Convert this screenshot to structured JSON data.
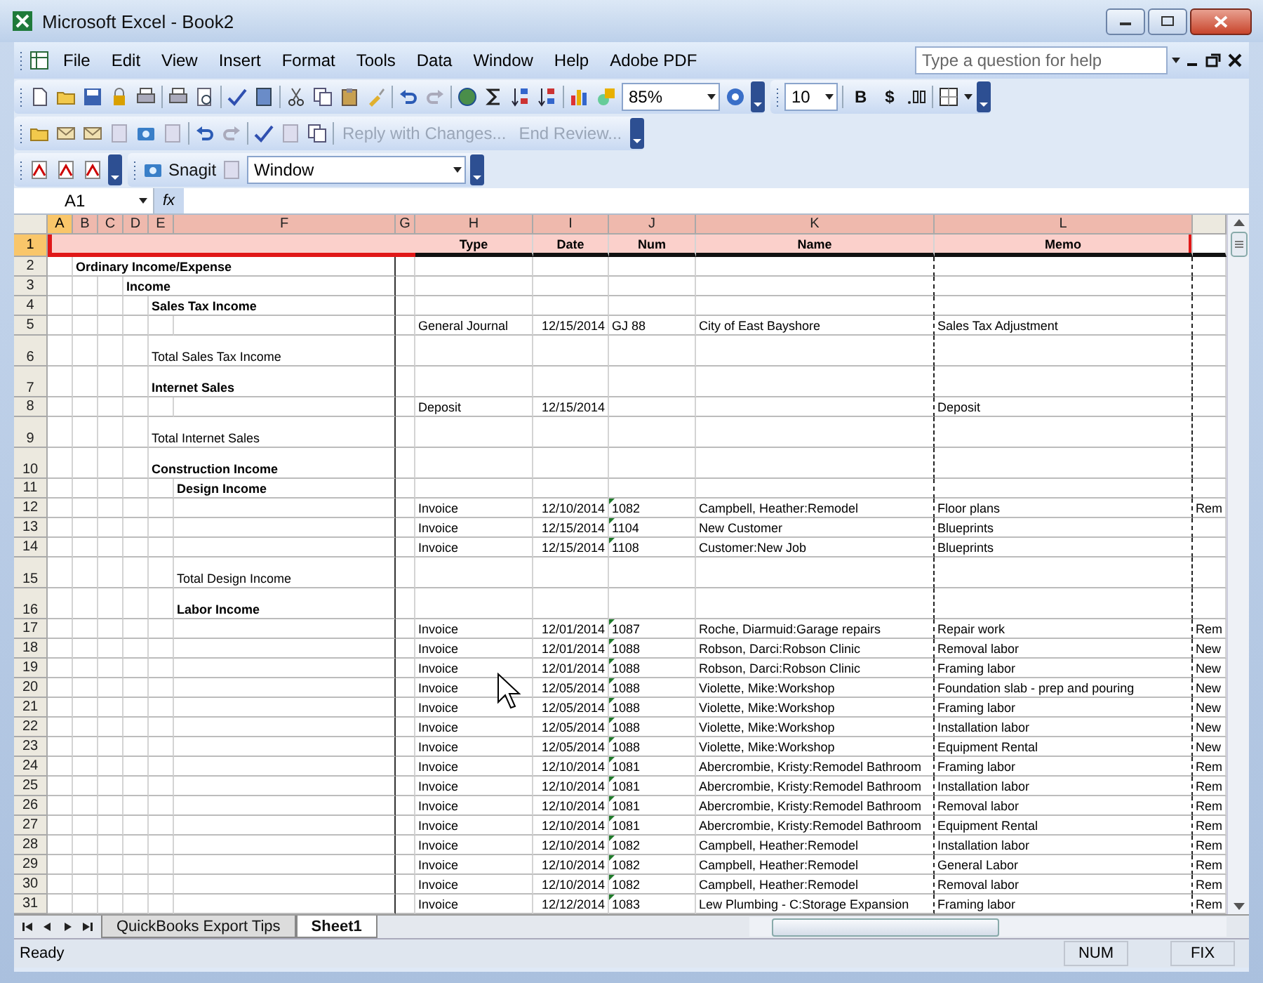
{
  "window": {
    "title": "Microsoft Excel - Book2"
  },
  "menu_bar": {
    "items": [
      "File",
      "Edit",
      "View",
      "Insert",
      "Format",
      "Tools",
      "Data",
      "Window",
      "Help",
      "Adobe PDF"
    ],
    "help_box": {
      "placeholder": "Type a question for help"
    }
  },
  "standard_toolbar": {
    "zoom": "85%"
  },
  "formatting_toolbar": {
    "font_size": "10",
    "buttons": [
      "B",
      "$"
    ]
  },
  "reviewing_toolbar": {
    "items": [
      {
        "label": "Reply with Changes...",
        "disabled": true
      },
      {
        "label": "End Review...",
        "disabled": true
      }
    ]
  },
  "snagit_toolbar": {
    "label": "Snagit",
    "dropdown": "Window"
  },
  "formula_bar": {
    "name_box": "A1",
    "fx": "fx"
  },
  "columns": [
    {
      "letter": "A",
      "selected": true
    },
    {
      "letter": "B",
      "selected": false
    },
    {
      "letter": "C",
      "selected": false
    },
    {
      "letter": "D",
      "selected": false
    },
    {
      "letter": "E",
      "selected": false
    },
    {
      "letter": "F",
      "selected": false
    },
    {
      "letter": "G",
      "selected": false
    },
    {
      "letter": "H",
      "selected": false
    },
    {
      "letter": "I",
      "selected": false
    },
    {
      "letter": "J",
      "selected": false
    },
    {
      "letter": "K",
      "selected": false
    },
    {
      "letter": "L",
      "selected": false
    }
  ],
  "header_row": {
    "number": "1",
    "selected": true,
    "cells": [
      "Type",
      "Date",
      "Num",
      "Name",
      "Memo"
    ]
  },
  "rows": [
    {
      "number": "2",
      "tall": false,
      "label": {
        "text": "Ordinary Income/Expense",
        "kind": "top",
        "bold": true
      }
    },
    {
      "number": "3",
      "tall": false,
      "label": {
        "text": "Income",
        "kind": "group",
        "bold": true
      }
    },
    {
      "number": "4",
      "tall": false,
      "label": {
        "text": "Sales Tax Income",
        "kind": "section",
        "bold": true
      }
    },
    {
      "number": "5",
      "tall": false,
      "type": "General Journal",
      "date": "12/15/2014",
      "num": "GJ 88",
      "num_flagged": false,
      "name": "City of East Bayshore",
      "memo": "Sales Tax Adjustment"
    },
    {
      "number": "6",
      "tall": true,
      "label": {
        "text": "Total Sales Tax Income",
        "kind": "section",
        "bold": false
      }
    },
    {
      "number": "7",
      "tall": true,
      "label": {
        "text": "Internet Sales",
        "kind": "section",
        "bold": true
      }
    },
    {
      "number": "8",
      "tall": false,
      "type": "Deposit",
      "date": "12/15/2014",
      "memo": "Deposit"
    },
    {
      "number": "9",
      "tall": true,
      "label": {
        "text": "Total Internet Sales",
        "kind": "section",
        "bold": false
      }
    },
    {
      "number": "10",
      "tall": true,
      "label": {
        "text": "Construction Income",
        "kind": "section",
        "bold": true
      }
    },
    {
      "number": "11",
      "tall": false,
      "label": {
        "text": "Design Income",
        "kind": "subsection",
        "bold": true
      }
    },
    {
      "number": "12",
      "tall": false,
      "type": "Invoice",
      "date": "12/10/2014",
      "num": "1082",
      "num_flagged": true,
      "name": "Campbell, Heather:Remodel",
      "memo": "Floor plans",
      "m": "Rem"
    },
    {
      "number": "13",
      "tall": false,
      "type": "Invoice",
      "date": "12/15/2014",
      "num": "1104",
      "num_flagged": true,
      "name": "New Customer",
      "memo": "Blueprints"
    },
    {
      "number": "14",
      "tall": false,
      "type": "Invoice",
      "date": "12/15/2014",
      "num": "1108",
      "num_flagged": true,
      "name": "Customer:New Job",
      "memo": "Blueprints"
    },
    {
      "number": "15",
      "tall": true,
      "label": {
        "text": "Total Design Income",
        "kind": "subsection",
        "bold": false
      }
    },
    {
      "number": "16",
      "tall": true,
      "label": {
        "text": "Labor Income",
        "kind": "subsection",
        "bold": true
      }
    },
    {
      "number": "17",
      "tall": false,
      "type": "Invoice",
      "date": "12/01/2014",
      "num": "1087",
      "num_flagged": true,
      "name": "Roche, Diarmuid:Garage repairs",
      "memo": "Repair work",
      "m": "Rem"
    },
    {
      "number": "18",
      "tall": false,
      "type": "Invoice",
      "date": "12/01/2014",
      "num": "1088",
      "num_flagged": true,
      "name": "Robson, Darci:Robson Clinic",
      "memo": "Removal labor",
      "m": "New"
    },
    {
      "number": "19",
      "tall": false,
      "type": "Invoice",
      "date": "12/01/2014",
      "num": "1088",
      "num_flagged": true,
      "name": "Robson, Darci:Robson Clinic",
      "memo": "Framing labor",
      "m": "New"
    },
    {
      "number": "20",
      "tall": false,
      "type": "Invoice",
      "date": "12/05/2014",
      "num": "1088",
      "num_flagged": true,
      "name": "Violette, Mike:Workshop",
      "memo": "Foundation slab - prep and pouring",
      "m": "New"
    },
    {
      "number": "21",
      "tall": false,
      "type": "Invoice",
      "date": "12/05/2014",
      "num": "1088",
      "num_flagged": true,
      "name": "Violette, Mike:Workshop",
      "memo": "Framing labor",
      "m": "New"
    },
    {
      "number": "22",
      "tall": false,
      "type": "Invoice",
      "date": "12/05/2014",
      "num": "1088",
      "num_flagged": true,
      "name": "Violette, Mike:Workshop",
      "memo": "Installation labor",
      "m": "New"
    },
    {
      "number": "23",
      "tall": false,
      "type": "Invoice",
      "date": "12/05/2014",
      "num": "1088",
      "num_flagged": true,
      "name": "Violette, Mike:Workshop",
      "memo": "Equipment Rental",
      "m": "New"
    },
    {
      "number": "24",
      "tall": false,
      "type": "Invoice",
      "date": "12/10/2014",
      "num": "1081",
      "num_flagged": true,
      "name": "Abercrombie, Kristy:Remodel Bathroom",
      "memo": "Framing labor",
      "m": "Rem"
    },
    {
      "number": "25",
      "tall": false,
      "type": "Invoice",
      "date": "12/10/2014",
      "num": "1081",
      "num_flagged": true,
      "name": "Abercrombie, Kristy:Remodel Bathroom",
      "memo": "Installation labor",
      "m": "Rem"
    },
    {
      "number": "26",
      "tall": false,
      "type": "Invoice",
      "date": "12/10/2014",
      "num": "1081",
      "num_flagged": true,
      "name": "Abercrombie, Kristy:Remodel Bathroom",
      "memo": "Removal labor",
      "m": "Rem"
    },
    {
      "number": "27",
      "tall": false,
      "type": "Invoice",
      "date": "12/10/2014",
      "num": "1081",
      "num_flagged": true,
      "name": "Abercrombie, Kristy:Remodel Bathroom",
      "memo": "Equipment Rental",
      "m": "Rem"
    },
    {
      "number": "28",
      "tall": false,
      "type": "Invoice",
      "date": "12/10/2014",
      "num": "1082",
      "num_flagged": true,
      "name": "Campbell, Heather:Remodel",
      "memo": "Installation labor",
      "m": "Rem"
    },
    {
      "number": "29",
      "tall": false,
      "type": "Invoice",
      "date": "12/10/2014",
      "num": "1082",
      "num_flagged": true,
      "name": "Campbell, Heather:Remodel",
      "memo": "General Labor",
      "m": "Rem"
    },
    {
      "number": "30",
      "tall": false,
      "type": "Invoice",
      "date": "12/10/2014",
      "num": "1082",
      "num_flagged": true,
      "name": "Campbell, Heather:Remodel",
      "memo": "Removal labor",
      "m": "Rem"
    },
    {
      "number": "31",
      "tall": false,
      "type": "Invoice",
      "date": "12/12/2014",
      "num": "1083",
      "num_flagged": true,
      "name": "Lew Plumbing - C:Storage Expansion",
      "memo": "Framing labor",
      "m": "Rem"
    }
  ],
  "sheet_tabs": [
    {
      "label": "QuickBooks Export Tips",
      "selected": false
    },
    {
      "label": "Sheet1",
      "selected": true
    }
  ],
  "status_bar": {
    "status": "Ready",
    "indicators": [
      "NUM",
      "FIX"
    ]
  }
}
